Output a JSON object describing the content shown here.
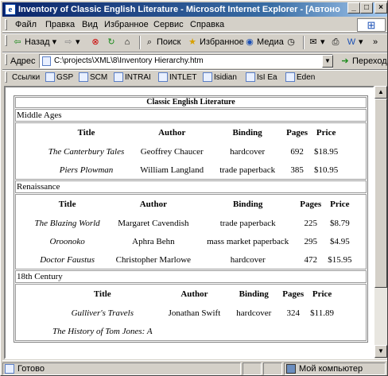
{
  "window": {
    "title": "Inventory of Classic English Literature - Microsoft Internet Explorer - [Автоно",
    "min_icon": "minimize-icon",
    "max_icon": "maximize-icon",
    "close_icon": "close-icon"
  },
  "menu": [
    "Файл",
    "Правка",
    "Вид",
    "Избранное",
    "Сервис",
    "Справка"
  ],
  "toolbar": {
    "back": "Назад",
    "search": "Поиск",
    "favorites": "Избранное",
    "media": "Медиа"
  },
  "address": {
    "label": "Адрес",
    "url": "C:\\projects\\XML\\8\\Inventory Hierarchy.htm",
    "go": "Переход"
  },
  "links": [
    "Ссылки",
    "GSP",
    "SCM",
    "INTRAI",
    "INTLET",
    "Isidian",
    "IsI Ea",
    "Eden"
  ],
  "colors": {
    "title_start": "#0a246a",
    "title_end": "#a6caf0"
  },
  "document": {
    "title": "Classic English Literature",
    "columns": [
      "Title",
      "Author",
      "Binding",
      "Pages",
      "Price"
    ],
    "eras": [
      {
        "name": "Middle Ages",
        "books": [
          {
            "title": "The Canterbury Tales",
            "author": "Geoffrey Chaucer",
            "binding": "hardcover",
            "pages": "692",
            "price": "$18.95"
          },
          {
            "title": "Piers Plowman",
            "author": "William Langland",
            "binding": "trade paperback",
            "pages": "385",
            "price": "$10.95"
          }
        ]
      },
      {
        "name": "Renaissance",
        "books": [
          {
            "title": "The Blazing World",
            "author": "Margaret Cavendish",
            "binding": "trade paperback",
            "pages": "225",
            "price": "$8.79"
          },
          {
            "title": "Oroonoko",
            "author": "Aphra Behn",
            "binding": "mass market paperback",
            "pages": "295",
            "price": "$4.95"
          },
          {
            "title": "Doctor Faustus",
            "author": "Christopher Marlowe",
            "binding": "hardcover",
            "pages": "472",
            "price": "$15.95"
          }
        ]
      },
      {
        "name": "18th Century",
        "books": [
          {
            "title": "Gulliver's Travels",
            "author": "Jonathan Swift",
            "binding": "hardcover",
            "pages": "324",
            "price": "$11.89"
          },
          {
            "title": "The History of Tom Jones: A",
            "author": "",
            "binding": "",
            "pages": "",
            "price": ""
          }
        ]
      }
    ]
  },
  "status": {
    "left": "Готово",
    "zone": "Мой компьютер"
  }
}
